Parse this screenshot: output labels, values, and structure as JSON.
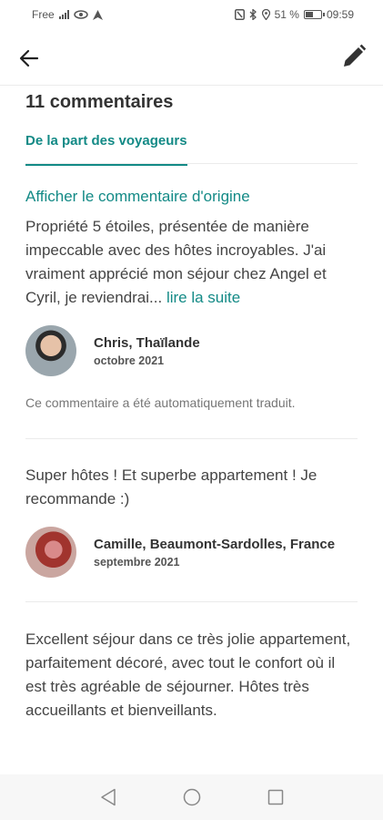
{
  "status_bar": {
    "carrier": "Free",
    "network": "4G",
    "battery": "51 %",
    "time": "09:59"
  },
  "app_bar": {
    "back_icon": "arrow-left-icon",
    "edit_icon": "pencil-icon"
  },
  "page": {
    "title": "11 commentaires",
    "tab_label": "De la part des voyageurs"
  },
  "reviews": [
    {
      "show_original": "Afficher le commentaire d'origine",
      "text": "Propriété 5 étoiles, présentée de manière impeccable avec des hôtes incroyables. J'ai vraiment apprécié mon séjour chez Angel et Cyril, je reviendrai... ",
      "read_more": "lire la suite",
      "author": "Chris, Thaïlande",
      "date": "octobre 2021",
      "translated_note": "Ce commentaire a été automatiquement traduit."
    },
    {
      "text": "Super hôtes ! Et superbe appartement ! Je recommande :)",
      "author": "Camille, Beaumont-Sardolles, France",
      "date": "septembre 2021"
    },
    {
      "text": "Excellent séjour dans ce très jolie appartement, parfaitement décoré, avec tout le confort où il est très  agréable de séjourner. Hôtes très accueillants et bienveillants."
    }
  ],
  "nav_bar": {
    "back_icon": "triangle-back-icon",
    "home_icon": "circle-home-icon",
    "recents_icon": "square-recents-icon"
  },
  "colors": {
    "accent": "#138a86",
    "text": "#444444",
    "divider": "#ebebeb"
  }
}
